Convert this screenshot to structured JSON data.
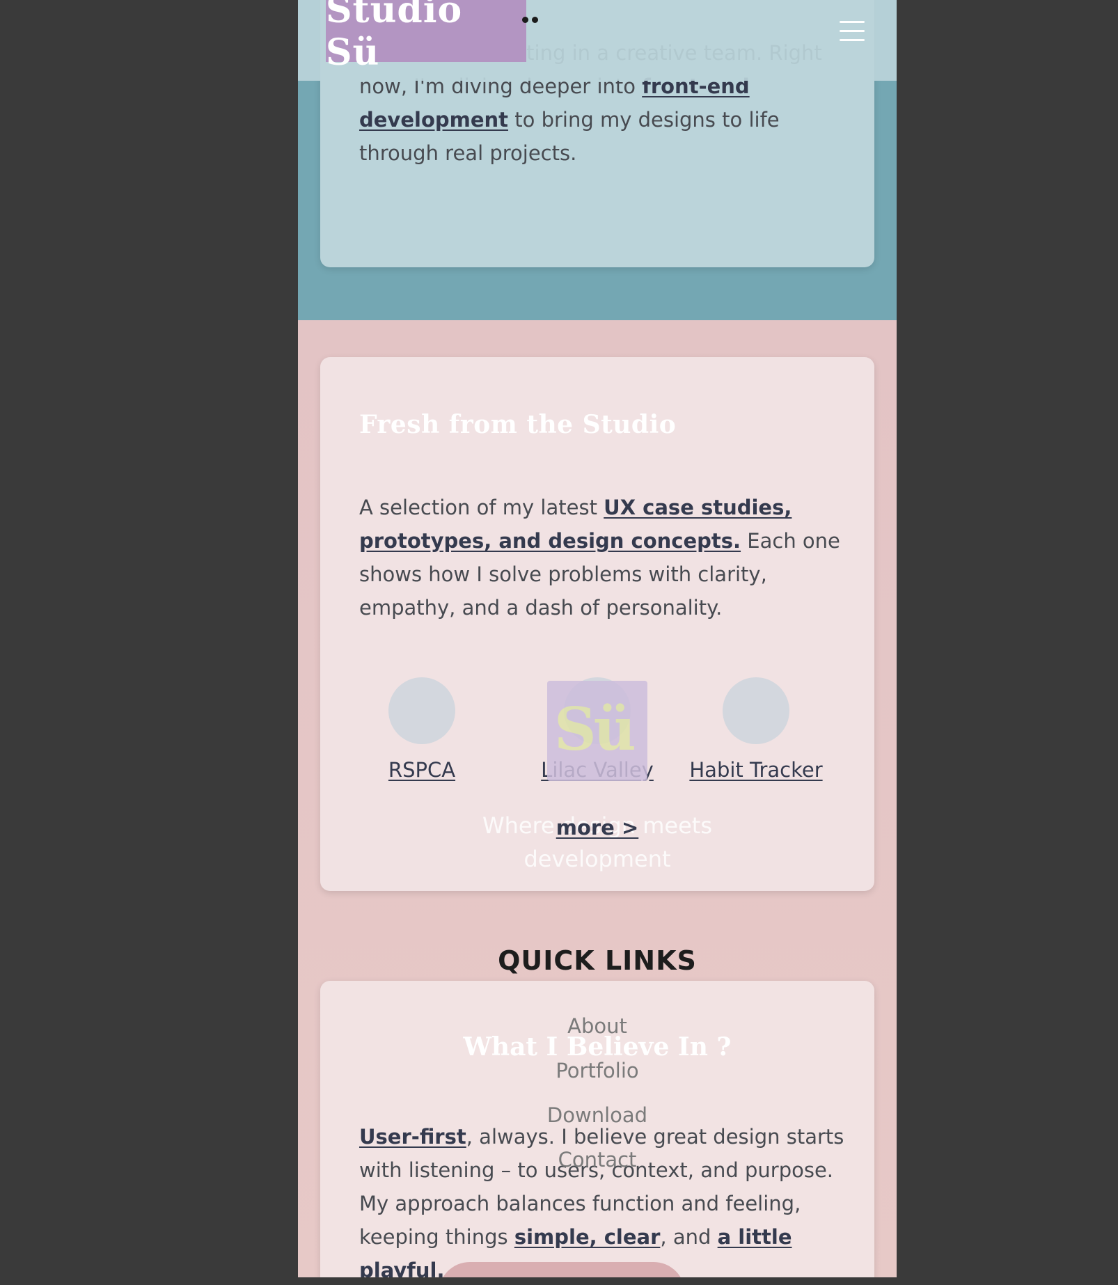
{
  "header": {
    "logo_text": "Studio Sü",
    "menu_icon": "hamburger-menu-icon"
  },
  "about": {
    "text_before": "solo or collaborating in a creative team. Right now, I'm diving deeper into ",
    "link_front_end": "front-end development",
    "text_after": " to bring my designs to life through real projects."
  },
  "fresh": {
    "title": "Fresh from the Studio",
    "text_before": "A selection of my latest ",
    "link_case_studies": "UX case studies, prototypes, and design concepts.",
    "text_after": " Each one shows how I solve problems with clarity, empathy, and a dash of personality.",
    "projects": [
      {
        "label": "RSPCA"
      },
      {
        "label": "Lilac Valley"
      },
      {
        "label": "Habit Tracker"
      }
    ],
    "more_label": "more >"
  },
  "footer": {
    "tagline": "Where design meets development",
    "quick_links_heading": "QUICK LINKS",
    "quick_links": [
      "About",
      "Portfolio",
      "Download",
      "Contact"
    ]
  },
  "believe": {
    "title": "What I Believe In ?",
    "link_user_first": "User-first",
    "text_1": ", always. I believe great design starts with listening – to users, context, and purpose. My approach balances function and feeling, keeping things ",
    "link_simple_clear": "simple, clear",
    "text_2": ", and ",
    "link_playful": "a little playful.",
    "text_3": "."
  },
  "colors": {
    "page_background": "#3a3a3a",
    "about_section": "#74a7b3",
    "about_card": "#bbd4da",
    "pink_section": "#e6c6c6",
    "card": "#f1e2e3",
    "logo_background": "#b395c2",
    "link_text": "#343a4e",
    "body_text": "#474a50"
  }
}
